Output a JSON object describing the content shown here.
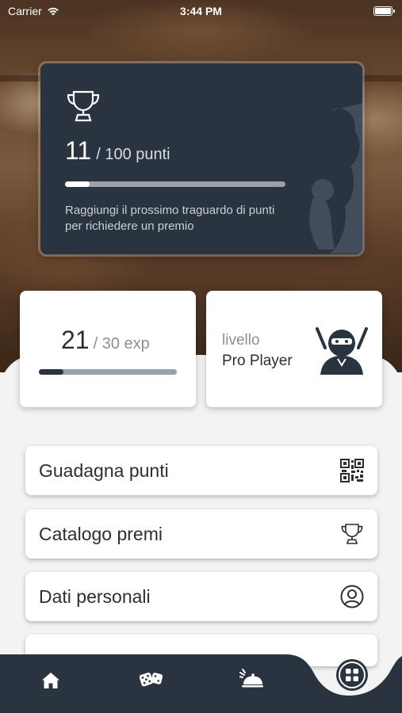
{
  "status_bar": {
    "carrier": "Carrier",
    "time": "3:44 PM"
  },
  "points_card": {
    "icon": "trophy-icon",
    "current": "11",
    "target": "/ 100 punti",
    "progress_fraction": 0.11,
    "message": "Raggiungi il prossimo traguardo di punti per richiedere un premio"
  },
  "exp_card": {
    "current": "21",
    "target": "/ 30 exp",
    "progress_fraction": 0.18
  },
  "level_card": {
    "label": "livello",
    "name": "Pro Player",
    "icon": "ninja-icon"
  },
  "menu": [
    {
      "label": "Guadagna punti",
      "icon": "qr-code-icon"
    },
    {
      "label": "Catalogo premi",
      "icon": "trophy-icon"
    },
    {
      "label": "Dati personali",
      "icon": "user-icon"
    }
  ],
  "tabbar": {
    "items": [
      {
        "icon": "home-icon"
      },
      {
        "icon": "dice-icon"
      },
      {
        "icon": "cloche-icon"
      },
      {
        "icon": "grid-icon",
        "active": true
      }
    ]
  },
  "colors": {
    "dark": "#2a3340",
    "sheet": "#f3f3f3",
    "card": "#ffffff"
  }
}
